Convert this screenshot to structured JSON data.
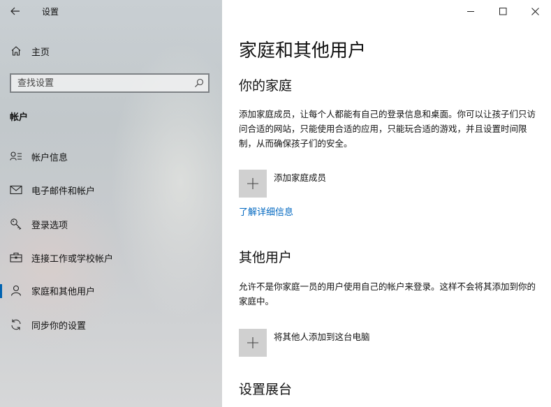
{
  "window": {
    "title": "设置",
    "controls": [
      "minimize",
      "maximize",
      "close"
    ]
  },
  "sidebar": {
    "home_label": "主页",
    "search_placeholder": "查找设置",
    "section_heading": "帐户",
    "items": [
      {
        "label": "帐户信息",
        "icon": "account-info-icon",
        "active": false
      },
      {
        "label": "电子邮件和帐户",
        "icon": "mail-icon",
        "active": false
      },
      {
        "label": "登录选项",
        "icon": "key-icon",
        "active": false
      },
      {
        "label": "连接工作或学校帐户",
        "icon": "briefcase-icon",
        "active": false
      },
      {
        "label": "家庭和其他用户",
        "icon": "person-icon",
        "active": true
      },
      {
        "label": "同步你的设置",
        "icon": "sync-icon",
        "active": false
      }
    ]
  },
  "main": {
    "page_title": "家庭和其他用户",
    "family": {
      "heading": "你的家庭",
      "description": "添加家庭成员，让每个人都能有自己的登录信息和桌面。你可以让孩子们只访问合适的网站，只能使用合适的应用，只能玩合适的游戏，并且设置时间限制，从而确保孩子们的安全。",
      "add_label": "添加家庭成员",
      "learn_more": "了解详细信息"
    },
    "others": {
      "heading": "其他用户",
      "description": "允许不是你家庭一员的用户使用自己的帐户来登录。这样不会将其添加到你的家庭中。",
      "add_label": "将其他人添加到这台电脑"
    },
    "kiosk": {
      "heading": "设置展台"
    }
  },
  "colors": {
    "accent": "#0063b1",
    "link": "#0067c0",
    "tile": "#d0d0d0"
  }
}
